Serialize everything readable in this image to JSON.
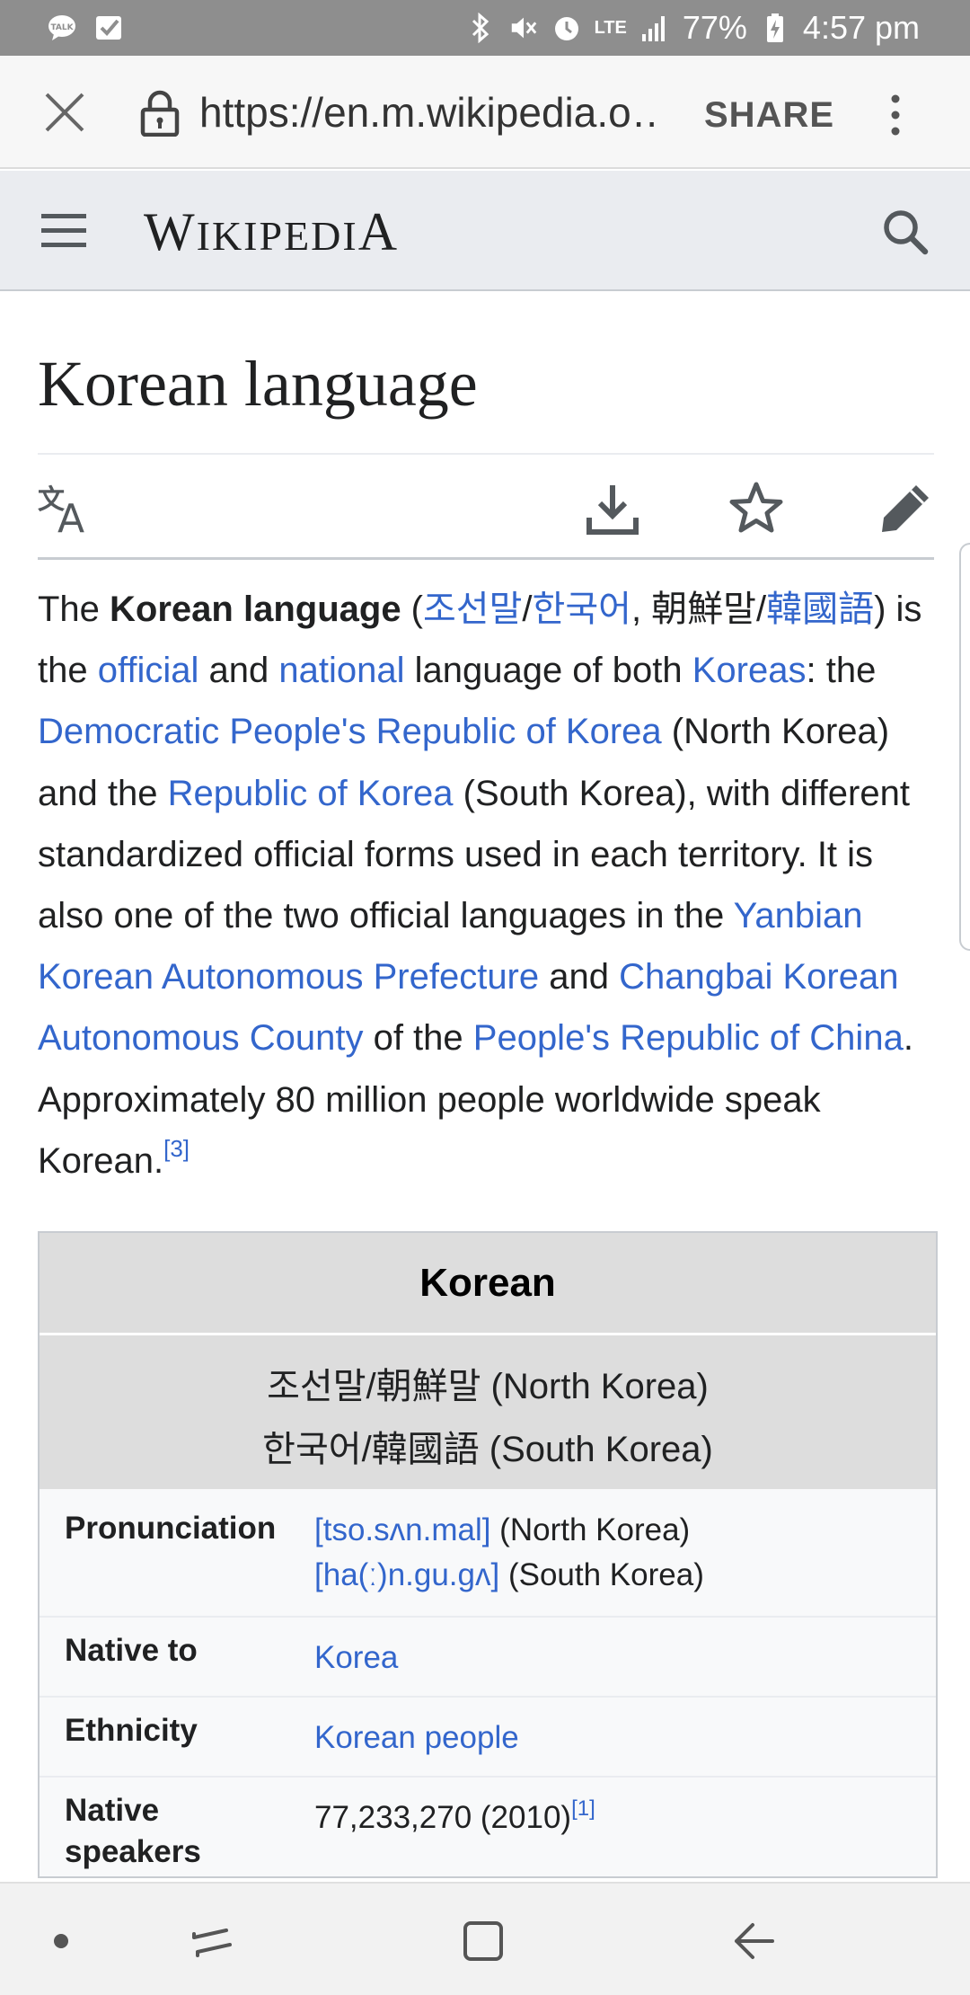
{
  "status_bar": {
    "battery": "77%",
    "time": "4:57 pm",
    "network": "LTE"
  },
  "browser": {
    "url": "https://en.m.wikipedia.o…",
    "share_label": "SHARE"
  },
  "wiki_header": {
    "logo_w": "W",
    "logo_mid": "IKIPEDI",
    "logo_a": "A"
  },
  "article": {
    "title": "Korean language",
    "intro": {
      "t1": "The ",
      "b1": "Korean language",
      "t2": " (",
      "l_josonmal": "조선말",
      "t3": "/",
      "l_hangugeo": "한국어",
      "t4": ", 朝鮮말/",
      "l_hanja": "韓國語",
      "t5": ") is the ",
      "l_official": "official",
      "t6": " and ",
      "l_national": "national",
      "t7": " language of both ",
      "l_koreas": "Koreas",
      "t8": ": the ",
      "l_dprk": "Democratic People's Republic of Korea",
      "t9": " (North Korea) and the ",
      "l_rok": "Republic of Korea",
      "t10": " (South Korea), with different standardized official forms used in each territory. It is also one of the two official languages in the ",
      "l_yanbian": "Yanbian Korean Autonomous Prefecture",
      "t11": " and ",
      "l_changbai": "Changbai Korean Autonomous County",
      "t12": " of the ",
      "l_prc": "People's Republic of China",
      "t13": ". Approximately 80 million people worldwide speak Korean.",
      "ref": "[3]"
    }
  },
  "infobox": {
    "title": "Korean",
    "native_north": "조선말/朝鮮말 (North Korea)",
    "native_south": "한국어/韓國語 (South Korea)",
    "rows": [
      {
        "label": "Pronunciation",
        "link1": "[tso.sʌn.mal]",
        "text1": " (North Korea)",
        "link2": "[ha(ː)n.gu.gʌ]",
        "text2": " (South Korea)"
      },
      {
        "label": "Native to",
        "link": "Korea"
      },
      {
        "label": "Ethnicity",
        "link": "Korean people"
      },
      {
        "label_line1": "Native",
        "label_line2": "speakers",
        "value": "77,233,270 (2010)",
        "ref": "[1]"
      }
    ]
  },
  "icons": {
    "close": "close-icon",
    "lock": "lock-icon",
    "more": "more-vert-icon",
    "menu": "hamburger-menu-icon",
    "search": "search-icon",
    "language": "language-icon",
    "download": "download-icon",
    "star": "star-icon",
    "edit": "pencil-icon"
  },
  "colors": {
    "link": "#3366cc",
    "status_bar": "#8e8e8e",
    "header_bg": "#eaecf0",
    "infobox_header": "#dddddd"
  }
}
